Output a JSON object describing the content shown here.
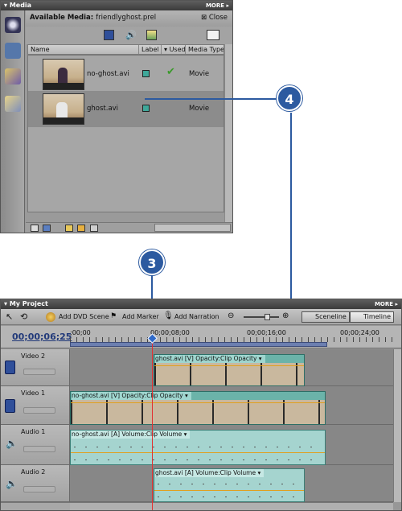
{
  "media_panel": {
    "title": "Media",
    "more": "MORE",
    "available_media_label": "Available Media:",
    "project_file": "friendlyghost.prel",
    "close_label": "Close",
    "columns": [
      "Name",
      "Label",
      "Used",
      "Media Type"
    ],
    "rows": [
      {
        "name": "no-ghost.avi",
        "used": true,
        "type": "Movie"
      },
      {
        "name": "ghost.avi",
        "used": false,
        "type": "Movie"
      }
    ]
  },
  "callouts": {
    "a": "4",
    "b": "3"
  },
  "project_panel": {
    "title": "My Project",
    "more": "MORE",
    "toolbar": {
      "add_dvd_scene": "Add DVD Scene",
      "add_marker": "Add Marker",
      "add_narration": "Add Narration",
      "sceneline": "Sceneline",
      "timeline": "Timeline"
    },
    "timecode": "00;00;06;25",
    "ruler_labels": [
      ";00;00",
      "00;00;08;00",
      "00;00;16;00",
      "00;00;24;00"
    ],
    "tracks": [
      {
        "name": "Video 2",
        "clip": "ghost.avi [V]  Opacity:Clip Opacity ▾"
      },
      {
        "name": "Video 1",
        "clip": "no-ghost.avi [V]  Opacity:Clip Opacity ▾"
      },
      {
        "name": "Audio 1",
        "clip": "no-ghost.avi [A]  Volume:Clip Volume ▾"
      },
      {
        "name": "Audio 2",
        "clip": "ghost.avi [A]  Volume:Clip Volume ▾"
      }
    ]
  },
  "colors": {
    "callout": "#2c5aa0",
    "clip_video": "#6bb3a9",
    "clip_audio": "#a5d4cf",
    "playhead": "#e23030"
  }
}
